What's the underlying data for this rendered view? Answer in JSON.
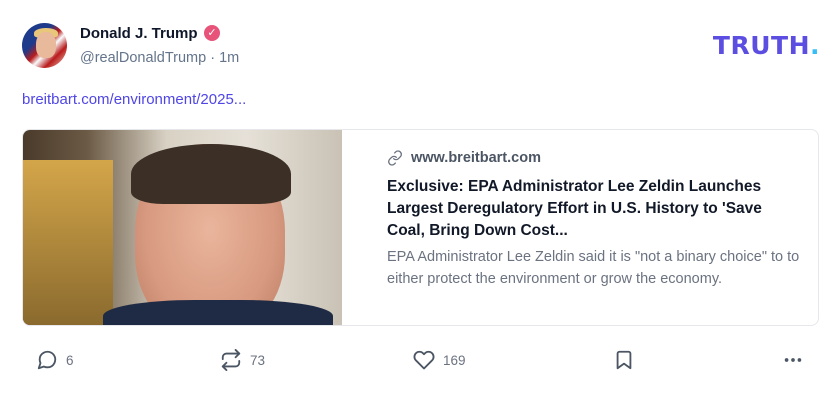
{
  "post": {
    "author": {
      "display_name": "Donald J. Trump",
      "handle": "@realDonaldTrump",
      "time": "1m",
      "verified_glyph": "✓"
    },
    "brand": {
      "logo_text": "TRUTH",
      "logo_dot": ".",
      "logo_color": "#5b4ee0",
      "dot_color": "#38bdf8"
    },
    "link_text": "breitbart.com/environment/2025...",
    "card": {
      "domain": "www.breitbart.com",
      "title": "Exclusive: EPA Administrator Lee Zeldin Launches Largest Deregulatory Effort in U.S. History to 'Save Coal, Bring Down Cost...",
      "description": "EPA Administrator Lee Zeldin said it is \"not a binary choice\" to to either protect the environment or grow the economy.",
      "icon": "link-icon"
    },
    "actions": {
      "replies": {
        "count": "6",
        "icon": "reply-icon"
      },
      "retruths": {
        "count": "73",
        "icon": "repost-icon"
      },
      "likes": {
        "count": "169",
        "icon": "heart-icon"
      },
      "bookmark": {
        "icon": "bookmark-icon"
      },
      "more": {
        "icon": "more-icon"
      }
    },
    "colors": {
      "link": "#4f46e5",
      "verified": "#e8537a",
      "muted": "#64748b"
    }
  }
}
